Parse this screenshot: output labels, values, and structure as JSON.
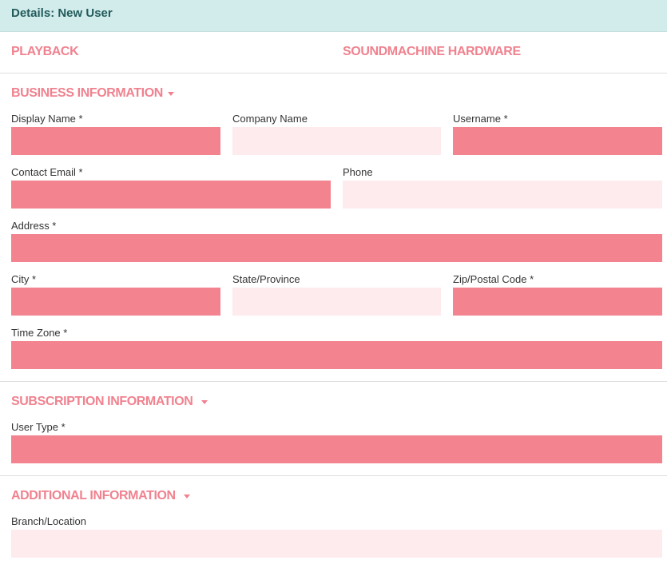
{
  "header": {
    "title": "Details: New User"
  },
  "nav": {
    "playback": "PLAYBACK",
    "hardware": "SOUNDMACHINE HARDWARE"
  },
  "sections": {
    "business": "BUSINESS INFORMATION",
    "subscription": "SUBSCRIPTION INFORMATION",
    "additional": "ADDITIONAL INFORMATION"
  },
  "fields": {
    "display_name": {
      "label": "Display Name *",
      "value": ""
    },
    "company_name": {
      "label": "Company Name",
      "value": ""
    },
    "username": {
      "label": "Username *",
      "value": ""
    },
    "contact_email": {
      "label": "Contact Email *",
      "value": ""
    },
    "phone": {
      "label": "Phone",
      "value": ""
    },
    "address": {
      "label": "Address *",
      "value": ""
    },
    "city": {
      "label": "City *",
      "value": ""
    },
    "state": {
      "label": "State/Province",
      "value": ""
    },
    "zip": {
      "label": "Zip/Postal Code *",
      "value": ""
    },
    "timezone": {
      "label": "Time Zone *",
      "value": ""
    },
    "user_type": {
      "label": "User Type *",
      "value": ""
    },
    "branch": {
      "label": "Branch/Location",
      "value": ""
    }
  },
  "colors": {
    "header_bg": "#d2ebeb",
    "header_text": "#225b5b",
    "accent": "#f0828f",
    "required_field": "#f2838f",
    "optional_field": "#fdebee"
  },
  "icons": {
    "section_toggle": "caret-down-icon"
  }
}
